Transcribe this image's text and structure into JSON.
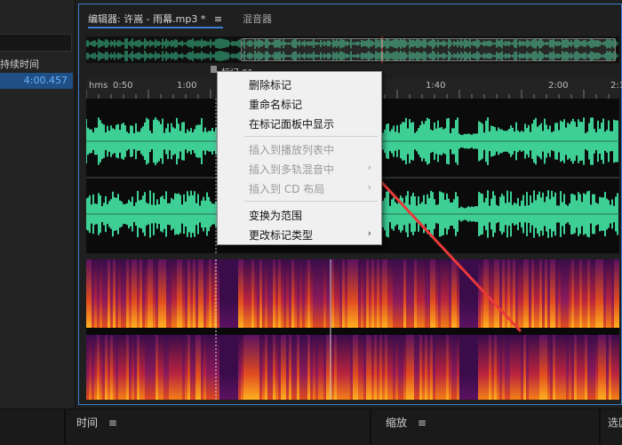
{
  "left_panel": {
    "duration_header": "持续时间",
    "duration_value": "4:00.457"
  },
  "tabs": {
    "editor": "编辑器: 许嵩 - 雨幕.mp3 *",
    "editor_menu_icon": "≡",
    "mixer": "混音器"
  },
  "marker": {
    "label": "标记 01"
  },
  "ruler": {
    "unit": "hms",
    "ticks": [
      "0:50",
      "1:00",
      "1:40",
      "2:00",
      "2:1"
    ]
  },
  "context_menu": {
    "items": [
      {
        "label": "删除标记",
        "enabled": true,
        "submenu": false
      },
      {
        "label": "重命名标记",
        "enabled": true,
        "submenu": false
      },
      {
        "label": "在标记面板中显示",
        "enabled": true,
        "submenu": false
      },
      {
        "label": "插入到播放列表中",
        "enabled": false,
        "submenu": false
      },
      {
        "label": "插入到多轨混音中",
        "enabled": false,
        "submenu": true
      },
      {
        "label": "插入到 CD 布局",
        "enabled": false,
        "submenu": true
      },
      {
        "label": "变换为范围",
        "enabled": true,
        "submenu": false
      },
      {
        "label": "更改标记类型",
        "enabled": true,
        "submenu": true
      }
    ]
  },
  "bottom": {
    "time_label": "时间",
    "zoom_label": "缩放",
    "menu_icon": "≡",
    "right_partial": "选区"
  },
  "colors": {
    "accent": "#3b7fd3",
    "waveform": "#3ecf95",
    "arrow": "#e83a3a",
    "playhead": "#d43a3a"
  },
  "icons": {
    "hamburger": "menu-icon",
    "chevron": "chevron-right-icon"
  }
}
